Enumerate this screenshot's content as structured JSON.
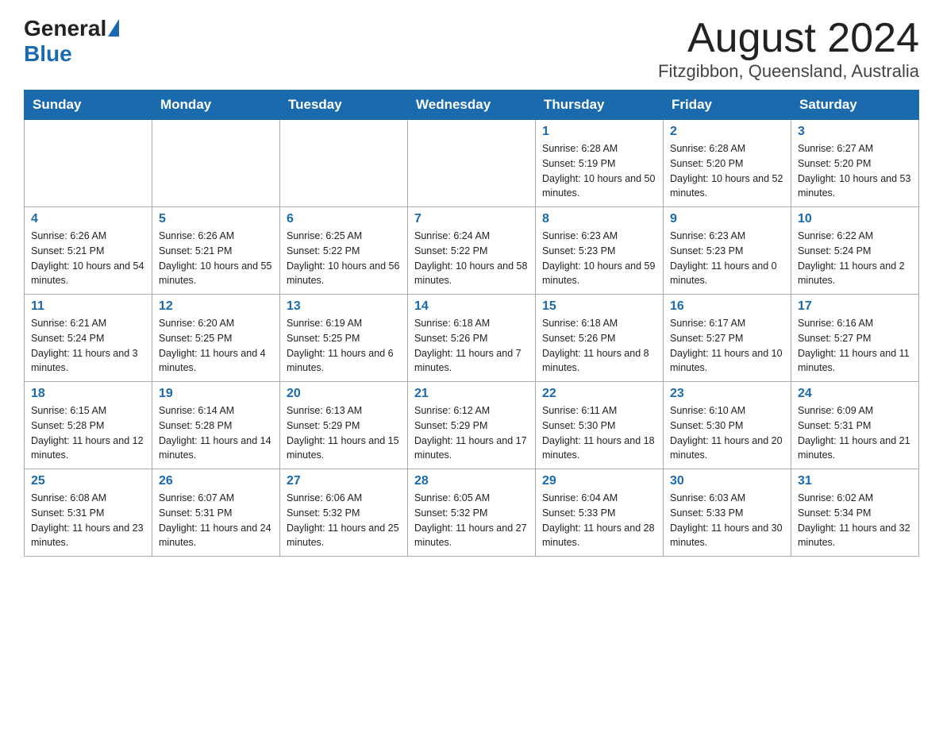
{
  "header": {
    "logo": {
      "general": "General",
      "triangle": "",
      "blue": "Blue"
    },
    "title": "August 2024",
    "subtitle": "Fitzgibbon, Queensland, Australia"
  },
  "calendar": {
    "days_of_week": [
      "Sunday",
      "Monday",
      "Tuesday",
      "Wednesday",
      "Thursday",
      "Friday",
      "Saturday"
    ],
    "weeks": [
      [
        {
          "day": "",
          "info": ""
        },
        {
          "day": "",
          "info": ""
        },
        {
          "day": "",
          "info": ""
        },
        {
          "day": "",
          "info": ""
        },
        {
          "day": "1",
          "info": "Sunrise: 6:28 AM\nSunset: 5:19 PM\nDaylight: 10 hours and 50 minutes."
        },
        {
          "day": "2",
          "info": "Sunrise: 6:28 AM\nSunset: 5:20 PM\nDaylight: 10 hours and 52 minutes."
        },
        {
          "day": "3",
          "info": "Sunrise: 6:27 AM\nSunset: 5:20 PM\nDaylight: 10 hours and 53 minutes."
        }
      ],
      [
        {
          "day": "4",
          "info": "Sunrise: 6:26 AM\nSunset: 5:21 PM\nDaylight: 10 hours and 54 minutes."
        },
        {
          "day": "5",
          "info": "Sunrise: 6:26 AM\nSunset: 5:21 PM\nDaylight: 10 hours and 55 minutes."
        },
        {
          "day": "6",
          "info": "Sunrise: 6:25 AM\nSunset: 5:22 PM\nDaylight: 10 hours and 56 minutes."
        },
        {
          "day": "7",
          "info": "Sunrise: 6:24 AM\nSunset: 5:22 PM\nDaylight: 10 hours and 58 minutes."
        },
        {
          "day": "8",
          "info": "Sunrise: 6:23 AM\nSunset: 5:23 PM\nDaylight: 10 hours and 59 minutes."
        },
        {
          "day": "9",
          "info": "Sunrise: 6:23 AM\nSunset: 5:23 PM\nDaylight: 11 hours and 0 minutes."
        },
        {
          "day": "10",
          "info": "Sunrise: 6:22 AM\nSunset: 5:24 PM\nDaylight: 11 hours and 2 minutes."
        }
      ],
      [
        {
          "day": "11",
          "info": "Sunrise: 6:21 AM\nSunset: 5:24 PM\nDaylight: 11 hours and 3 minutes."
        },
        {
          "day": "12",
          "info": "Sunrise: 6:20 AM\nSunset: 5:25 PM\nDaylight: 11 hours and 4 minutes."
        },
        {
          "day": "13",
          "info": "Sunrise: 6:19 AM\nSunset: 5:25 PM\nDaylight: 11 hours and 6 minutes."
        },
        {
          "day": "14",
          "info": "Sunrise: 6:18 AM\nSunset: 5:26 PM\nDaylight: 11 hours and 7 minutes."
        },
        {
          "day": "15",
          "info": "Sunrise: 6:18 AM\nSunset: 5:26 PM\nDaylight: 11 hours and 8 minutes."
        },
        {
          "day": "16",
          "info": "Sunrise: 6:17 AM\nSunset: 5:27 PM\nDaylight: 11 hours and 10 minutes."
        },
        {
          "day": "17",
          "info": "Sunrise: 6:16 AM\nSunset: 5:27 PM\nDaylight: 11 hours and 11 minutes."
        }
      ],
      [
        {
          "day": "18",
          "info": "Sunrise: 6:15 AM\nSunset: 5:28 PM\nDaylight: 11 hours and 12 minutes."
        },
        {
          "day": "19",
          "info": "Sunrise: 6:14 AM\nSunset: 5:28 PM\nDaylight: 11 hours and 14 minutes."
        },
        {
          "day": "20",
          "info": "Sunrise: 6:13 AM\nSunset: 5:29 PM\nDaylight: 11 hours and 15 minutes."
        },
        {
          "day": "21",
          "info": "Sunrise: 6:12 AM\nSunset: 5:29 PM\nDaylight: 11 hours and 17 minutes."
        },
        {
          "day": "22",
          "info": "Sunrise: 6:11 AM\nSunset: 5:30 PM\nDaylight: 11 hours and 18 minutes."
        },
        {
          "day": "23",
          "info": "Sunrise: 6:10 AM\nSunset: 5:30 PM\nDaylight: 11 hours and 20 minutes."
        },
        {
          "day": "24",
          "info": "Sunrise: 6:09 AM\nSunset: 5:31 PM\nDaylight: 11 hours and 21 minutes."
        }
      ],
      [
        {
          "day": "25",
          "info": "Sunrise: 6:08 AM\nSunset: 5:31 PM\nDaylight: 11 hours and 23 minutes."
        },
        {
          "day": "26",
          "info": "Sunrise: 6:07 AM\nSunset: 5:31 PM\nDaylight: 11 hours and 24 minutes."
        },
        {
          "day": "27",
          "info": "Sunrise: 6:06 AM\nSunset: 5:32 PM\nDaylight: 11 hours and 25 minutes."
        },
        {
          "day": "28",
          "info": "Sunrise: 6:05 AM\nSunset: 5:32 PM\nDaylight: 11 hours and 27 minutes."
        },
        {
          "day": "29",
          "info": "Sunrise: 6:04 AM\nSunset: 5:33 PM\nDaylight: 11 hours and 28 minutes."
        },
        {
          "day": "30",
          "info": "Sunrise: 6:03 AM\nSunset: 5:33 PM\nDaylight: 11 hours and 30 minutes."
        },
        {
          "day": "31",
          "info": "Sunrise: 6:02 AM\nSunset: 5:34 PM\nDaylight: 11 hours and 32 minutes."
        }
      ]
    ]
  }
}
